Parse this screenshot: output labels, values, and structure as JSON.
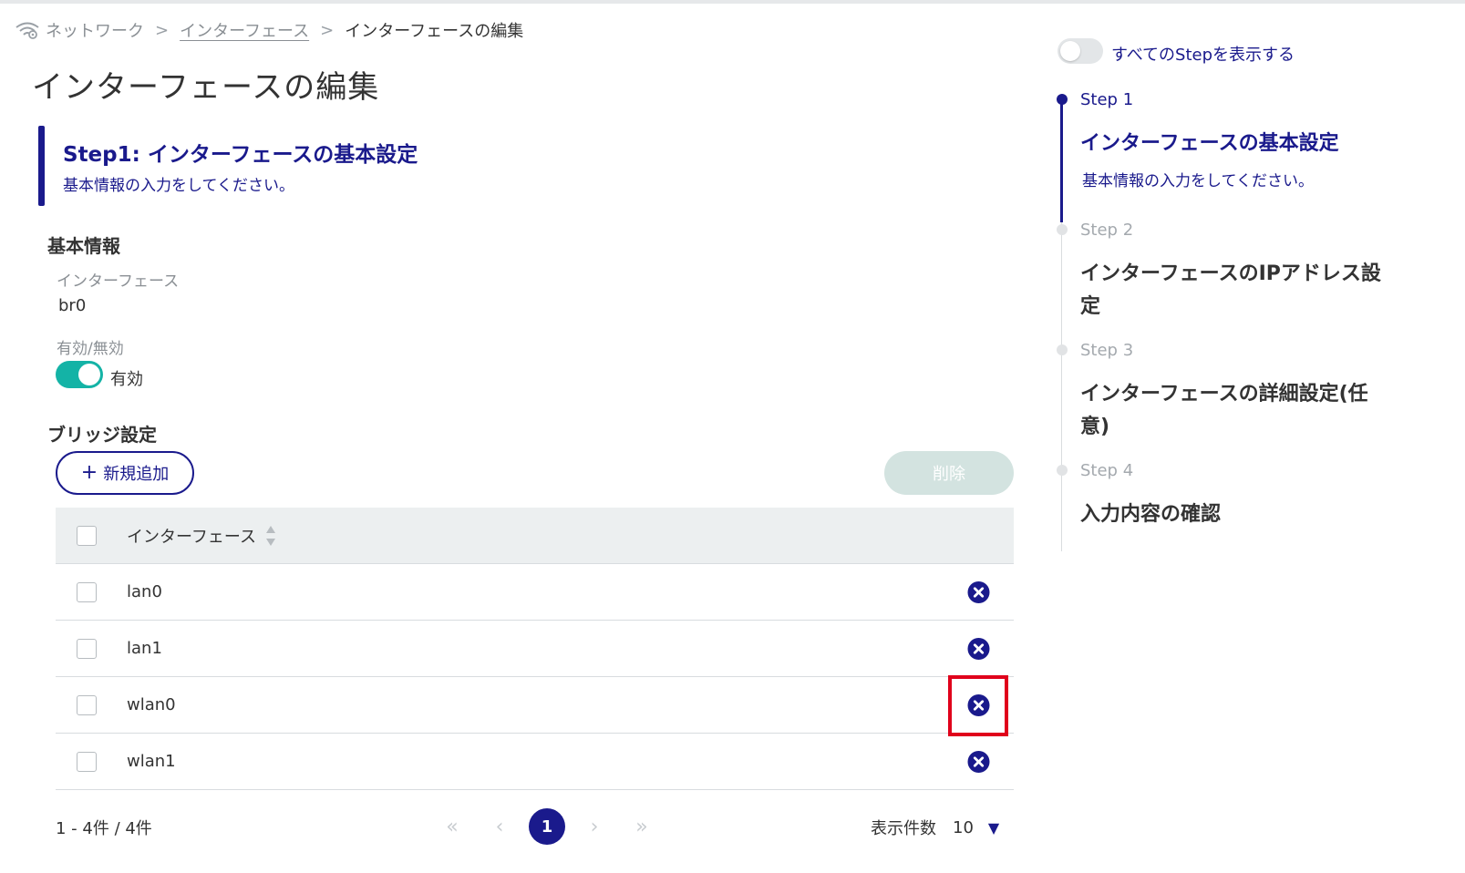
{
  "breadcrumb": {
    "root": "ネットワーク",
    "separator": ">",
    "parent": "インターフェース",
    "current": "インターフェースの編集"
  },
  "page_title": "インターフェースの編集",
  "step_header": {
    "title": "Step1: インターフェースの基本設定",
    "description": "基本情報の入力をしてください。"
  },
  "basic_info": {
    "section_title": "基本情報",
    "interface_label": "インターフェース",
    "interface_value": "br0",
    "enabled_label": "有効/無効",
    "enabled_value": "有効",
    "enabled": true
  },
  "bridge": {
    "section_title": "ブリッジ設定",
    "add_label": "新規追加",
    "delete_label": "削除",
    "table": {
      "column_header": "インターフェース",
      "rows": [
        {
          "name": "lan0"
        },
        {
          "name": "lan1"
        },
        {
          "name": "wlan0"
        },
        {
          "name": "wlan1"
        }
      ]
    },
    "pagination": {
      "range": "1 - 4件 / 4件",
      "first": "«",
      "prev": "‹",
      "current_page": "1",
      "next": "›",
      "last": "»",
      "per_page_label": "表示件数",
      "per_page_value": "10"
    }
  },
  "sidebar": {
    "show_all_label": "すべてのStepを表示する",
    "steps": [
      {
        "number": "Step 1",
        "name": "インターフェースの基本設定",
        "description": "基本情報の入力をしてください。",
        "active": true
      },
      {
        "number": "Step 2",
        "name": "インターフェースのIPアドレス設定",
        "active": false
      },
      {
        "number": "Step 3",
        "name": "インターフェースの詳細設定(任意)",
        "active": false
      },
      {
        "number": "Step 4",
        "name": "入力内容の確認",
        "active": false
      }
    ]
  },
  "colors": {
    "primary": "#1a1a8c",
    "toggle_on": "#14b3a6",
    "highlight": "#e0001b",
    "disabled_button": "#d3e3e0"
  }
}
